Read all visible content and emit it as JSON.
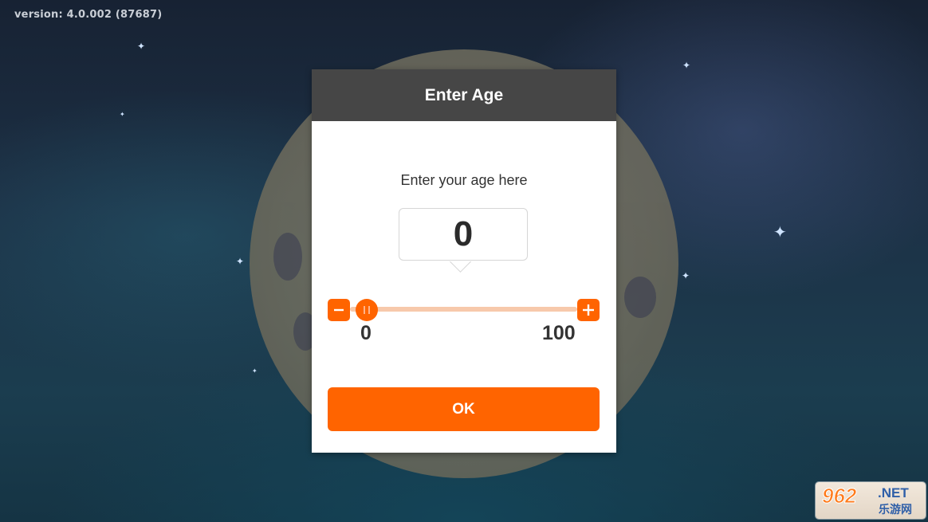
{
  "app": {
    "version_text": "version: 4.0.002 (87687)"
  },
  "dialog": {
    "title": "Enter Age",
    "prompt": "Enter your age here",
    "current_value": "0",
    "slider": {
      "min_label": "0",
      "max_label": "100",
      "value": 0,
      "min": 0,
      "max": 100,
      "decrement_icon": "minus-icon",
      "increment_icon": "plus-icon"
    },
    "ok_label": "OK"
  },
  "watermark": {
    "main": "962",
    "net": ".NET",
    "sub": "乐游网"
  },
  "colors": {
    "accent": "#ff6400",
    "header": "#464646",
    "track": "#f7c9ab"
  }
}
